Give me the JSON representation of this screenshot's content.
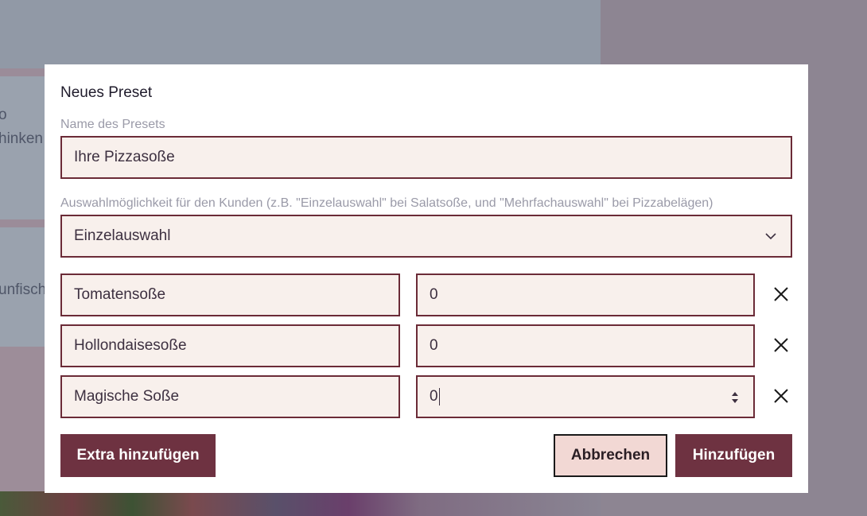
{
  "background": {
    "text_fragments": [
      "o",
      "hinken",
      "unfisch"
    ]
  },
  "modal": {
    "title": "Neues Preset",
    "name_label": "Name des Presets",
    "name_value": "Ihre Pizzasoße",
    "mode_label": "Auswahlmöglichkeit für den Kunden (z.B. \"Einzelauswahl\" bei Salatsoße, und \"Mehrfachauswahl\" bei Pizzabelägen)",
    "mode_value": "Einzelauswahl",
    "extras": [
      {
        "name": "Tomatensoße",
        "price": "0"
      },
      {
        "name": "Hollondaisesoße",
        "price": "0"
      },
      {
        "name": "Magische Soße",
        "price": "0"
      }
    ],
    "buttons": {
      "add_extra": "Extra hinzufügen",
      "cancel": "Abbrechen",
      "submit": "Hinzufügen"
    }
  },
  "colors": {
    "accent": "#6e3241",
    "input_border": "#6b2b37",
    "input_bg": "#f8f0ec",
    "cancel_bg": "#f2d8d4"
  },
  "icons": {
    "select": "chevron-down-icon",
    "remove": "close-icon",
    "number_spinner": "spinner-icon"
  }
}
